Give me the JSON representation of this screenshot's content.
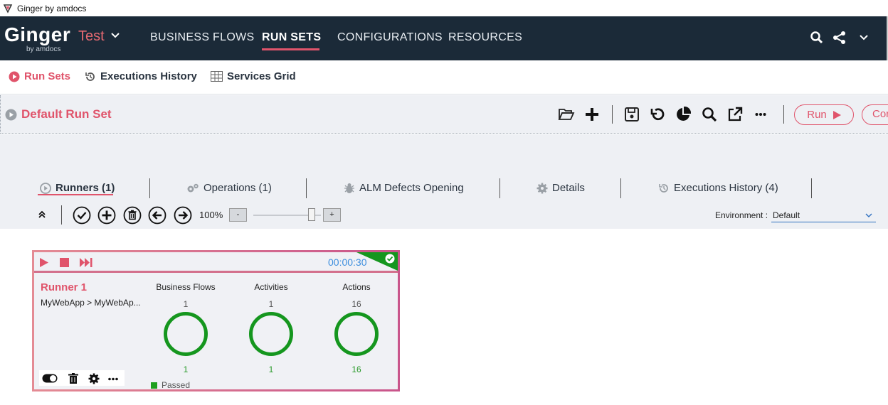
{
  "window": {
    "title": "Ginger by amdocs"
  },
  "brand": {
    "name": "Ginger",
    "sub": "by amdocs",
    "workspace": "Test"
  },
  "nav": {
    "items": [
      {
        "label": "BUSINESS FLOWS"
      },
      {
        "label": "RUN SETS"
      },
      {
        "label": "CONFIGURATIONS"
      },
      {
        "label": "RESOURCES"
      }
    ],
    "active_index": 1
  },
  "subtabs": [
    {
      "label": "Run Sets",
      "icon": "play-circle-icon"
    },
    {
      "label": "Executions History",
      "icon": "history-icon"
    },
    {
      "label": "Services Grid",
      "icon": "grid-icon"
    }
  ],
  "runset": {
    "title": "Default Run Set",
    "run_label": "Run",
    "continue_label": "Cor"
  },
  "runset_tabs": [
    {
      "label": "Runners (1)",
      "icon": "play-circle-icon"
    },
    {
      "label": "Operations (1)",
      "icon": "gears-icon"
    },
    {
      "label": "ALM Defects Opening",
      "icon": "bug-icon"
    },
    {
      "label": "Details",
      "icon": "gear-icon"
    },
    {
      "label": "Executions History (4)",
      "icon": "history-icon"
    }
  ],
  "toolbar": {
    "zoom": "100%",
    "zoom_minus": "-",
    "zoom_plus": "+",
    "zoom_level": 0.9,
    "environment_label": "Environment :",
    "environment_value": "Default"
  },
  "runner": {
    "name": "Runner 1",
    "path": "MyWebApp > MyWebAp...",
    "elapsed": "00:00:30",
    "status_legend": "Passed",
    "stats": [
      {
        "title": "Business Flows",
        "total": "1",
        "passed": "1"
      },
      {
        "title": "Activities",
        "total": "1",
        "passed": "1"
      },
      {
        "title": "Actions",
        "total": "16",
        "passed": "16"
      }
    ]
  },
  "colors": {
    "accent": "#e0546b",
    "nav_bg": "#1b2a38",
    "passed": "#1ea01e",
    "elapsed": "#3c8ede"
  }
}
